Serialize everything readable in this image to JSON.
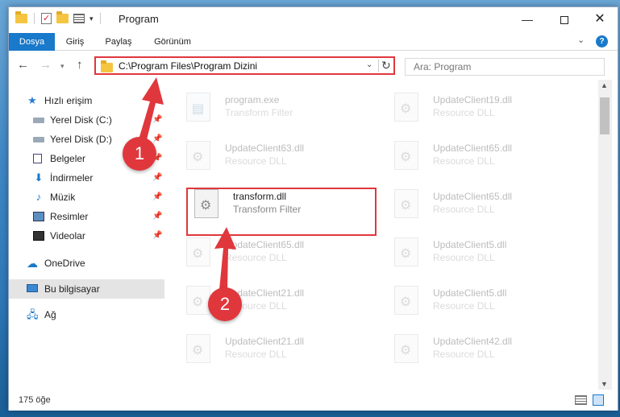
{
  "window": {
    "title": "Program"
  },
  "ribbon": {
    "tabs": [
      "Dosya",
      "Giriş",
      "Paylaş",
      "Görünüm"
    ]
  },
  "navigation": {
    "address": "C:\\Program Files\\Program Dizini",
    "search_placeholder": "Ara: Program"
  },
  "sidebar": {
    "quick_access": "Hızlı erişim",
    "items": [
      {
        "label": "Yerel Disk (C:)",
        "icon": "drive-icon",
        "pinned": true
      },
      {
        "label": "Yerel Disk (D:)",
        "icon": "drive-icon",
        "pinned": true
      },
      {
        "label": "Belgeler",
        "icon": "documents-icon",
        "pinned": true
      },
      {
        "label": "İndirmeler",
        "icon": "download-icon",
        "pinned": true
      },
      {
        "label": "Müzik",
        "icon": "music-icon",
        "pinned": true
      },
      {
        "label": "Resimler",
        "icon": "pictures-icon",
        "pinned": true
      },
      {
        "label": "Videolar",
        "icon": "videos-icon",
        "pinned": true
      }
    ],
    "onedrive": "OneDrive",
    "this_pc": "Bu bilgisayar",
    "network": "Ağ"
  },
  "files": {
    "left": [
      {
        "name": "program.exe",
        "desc": "Transform Filter",
        "type": "exe",
        "faded": true
      },
      {
        "name": "UpdateClient63.dll",
        "desc": "Resource DLL",
        "type": "dll",
        "faded": true
      },
      {
        "name": "transform.dll",
        "desc": "Transform Filter",
        "type": "dll",
        "faded": false
      },
      {
        "name": "UpdateClient65.dll",
        "desc": "Resource DLL",
        "type": "dll",
        "faded": true
      },
      {
        "name": "UpdateClient21.dll",
        "desc": "Resource DLL",
        "type": "dll",
        "faded": true
      },
      {
        "name": "UpdateClient21.dll",
        "desc": "Resource DLL",
        "type": "dll",
        "faded": true
      }
    ],
    "right": [
      {
        "name": "UpdateClient19.dll",
        "desc": "Resource DLL",
        "type": "dll",
        "faded": true
      },
      {
        "name": "UpdateClient65.dll",
        "desc": "Resource DLL",
        "type": "dll",
        "faded": true
      },
      {
        "name": "UpdateClient65.dll",
        "desc": "Resource DLL",
        "type": "dll",
        "faded": true
      },
      {
        "name": "UpdateClient5.dll",
        "desc": "Resource DLL",
        "type": "dll",
        "faded": true
      },
      {
        "name": "UpdateClient5.dll",
        "desc": "Resource DLL",
        "type": "dll",
        "faded": true
      },
      {
        "name": "UpdateClient42.dll",
        "desc": "Resource DLL",
        "type": "dll",
        "faded": true
      }
    ]
  },
  "status": {
    "count": "175 öğe"
  },
  "annotations": {
    "step1": "1",
    "step2": "2",
    "color": "#e0373d"
  }
}
